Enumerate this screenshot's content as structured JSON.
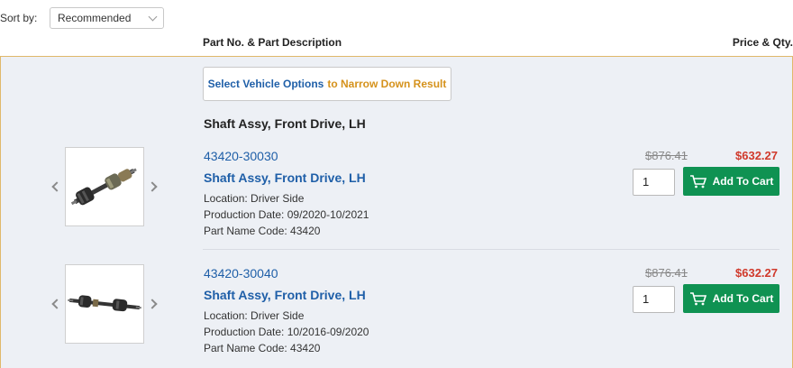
{
  "sort": {
    "label": "Sort by:",
    "selected": "Recommended"
  },
  "columns": {
    "part": "Part No. & Part Description",
    "price": "Price & Qty."
  },
  "options_button": {
    "part_a": "Select Vehicle Options",
    "part_b": "to Narrow Down Result"
  },
  "group_title": "Shaft Assy, Front Drive, LH",
  "parts": [
    {
      "part_no": "43420-30030",
      "name": "Shaft Assy, Front Drive, LH",
      "location": "Location: Driver Side",
      "production": "Production Date: 09/2020-10/2021",
      "code": "Part Name Code: 43420",
      "old_price": "$876.41",
      "price": "$632.27",
      "qty": "1",
      "cart_label": "Add To Cart"
    },
    {
      "part_no": "43420-30040",
      "name": "Shaft Assy, Front Drive, LH",
      "location": "Location: Driver Side",
      "production": "Production Date: 10/2016-09/2020",
      "code": "Part Name Code: 43420",
      "old_price": "$876.41",
      "price": "$632.27",
      "qty": "1",
      "cart_label": "Add To Cart"
    }
  ],
  "colors": {
    "link": "#1f5fa8",
    "accent": "#d5921c",
    "sale": "#d0392b",
    "cart": "#0f9252",
    "panel": "#edf0f5"
  },
  "icons": {
    "prev": "chevron-left-icon",
    "next": "chevron-right-icon",
    "cart": "cart-icon",
    "dropdown": "chevron-down-icon"
  }
}
